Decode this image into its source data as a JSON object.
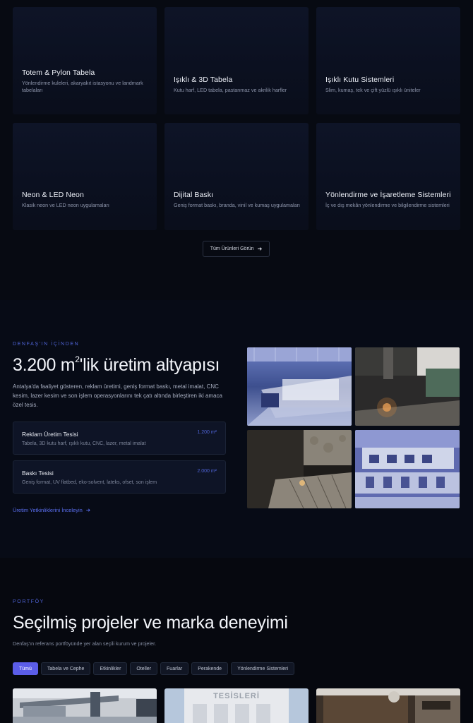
{
  "products": {
    "cards": [
      {
        "title": "Totem & Pylon Tabela",
        "desc": "Yönlendirme kuleleri, akaryakıt istasyonu ve landmark tabelaları"
      },
      {
        "title": "Işıklı & 3D Tabela",
        "desc": "Kutu harf, LED tabela, pastanmaz ve akrilik harfler"
      },
      {
        "title": "Işıklı Kutu Sistemleri",
        "desc": "Slim, kumaş, tek ve çift yüzlü ışıklı üniteler"
      },
      {
        "title": "Neon & LED Neon",
        "desc": "Klasik neon ve LED neon uygulamaları"
      },
      {
        "title": "Dijital Baskı",
        "desc": "Geniş format baskı, branda, vinil ve kumaş uygulamaları"
      },
      {
        "title": "Yönlendirme ve İşaretleme Sistemleri",
        "desc": "İç ve dış mekân yönlendirme ve bilgilendirme sistemleri"
      }
    ],
    "all_button": "Tüm Ürünleri Görün",
    "all_button_icon": "arrow-right-icon"
  },
  "facility": {
    "eyebrow": "DENFAŞ'IN İÇİNDEN",
    "title_main": "3.200 m",
    "title_sup": "2",
    "title_rest": "'lik üretim altyapısı",
    "description": "Antalya'da faaliyet gösteren, reklam üretimi, geniş format baskı, metal imalat, CNC kesim, lazer kesim ve son işlem operasyonlarını tek çatı altında birleştiren iki amaca özel tesis.",
    "cards": [
      {
        "name": "Reklam Üretim Tesisi",
        "area": "1.200 m²",
        "detail": "Tabela, 3D kutu harf, ışıklı kutu, CNC, lazer, metal imalat"
      },
      {
        "name": "Baskı Tesisi",
        "area": "2.000 m²",
        "detail": "Geniş format, UV flatbed, eko-solvent, lateks, ofset, son işlem"
      }
    ],
    "link": "Üretim Yetkinliklerini İnceleyin",
    "link_icon": "arrow-right-icon"
  },
  "portfolio": {
    "eyebrow": "PORTFÖY",
    "title": "Seçilmiş projeler ve marka deneyimi",
    "description": "Denfaş'ın referans portföyünde yer alan seçili kurum ve projeler.",
    "filters": [
      "Tümü",
      "Tabela ve Cephe",
      "Etkinlikler",
      "Oteller",
      "Fuarlar",
      "Perakende",
      "Yönlendirme Sistemleri"
    ],
    "active_filter": "Tümü",
    "sign_text": "TESİSLERİ"
  },
  "colors": {
    "accent": "#5b5de8",
    "eyebrow": "#4f63d6",
    "background": "#070a12",
    "card": "#0e1426"
  }
}
